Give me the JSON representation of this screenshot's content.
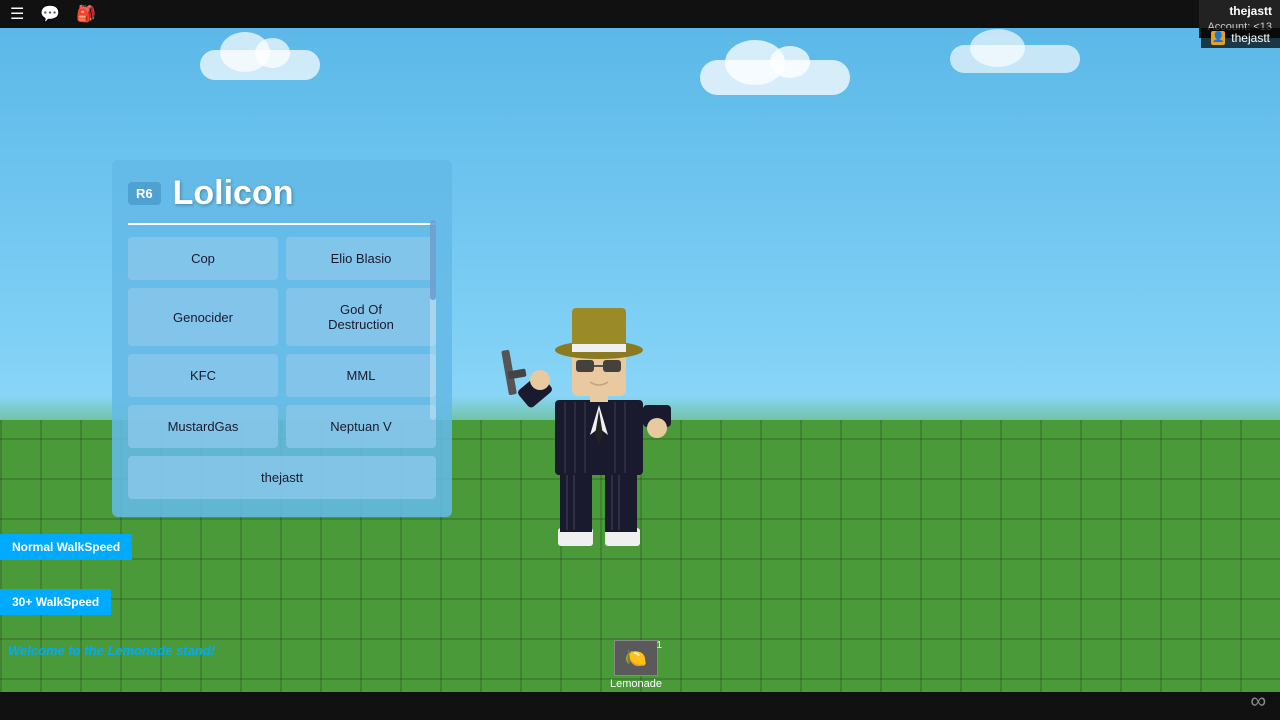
{
  "topbar": {
    "menu_icon": "☰",
    "chat_icon": "💬",
    "bag_icon": "🎒"
  },
  "account": {
    "username": "thejastt",
    "account_label": "Account:",
    "account_value": "<13"
  },
  "userbar": {
    "username": "thejastt"
  },
  "panel": {
    "r6_label": "R6",
    "title": "Lolicon",
    "buttons": [
      {
        "label": "Cop",
        "id": "cop"
      },
      {
        "label": "Elio Blasio",
        "id": "elio-blasio"
      },
      {
        "label": "Genocider",
        "id": "genocider"
      },
      {
        "label": "God Of Destruction",
        "id": "god-of-destruction"
      },
      {
        "label": "KFC",
        "id": "kfc"
      },
      {
        "label": "MML",
        "id": "mml"
      },
      {
        "label": "MustardGas",
        "id": "mustardgas"
      },
      {
        "label": "Neptuan V",
        "id": "neptuan-v"
      }
    ],
    "bottom_button": "thejastt"
  },
  "walkspeed": {
    "normal_label": "Normal WalkSpeed",
    "fast_label": "30+ WalkSpeed"
  },
  "welcome": {
    "text": "Welcome to the Lemonade stand!"
  },
  "lemonade": {
    "label": "Lemonade",
    "count": "1"
  },
  "infinity": "∞"
}
